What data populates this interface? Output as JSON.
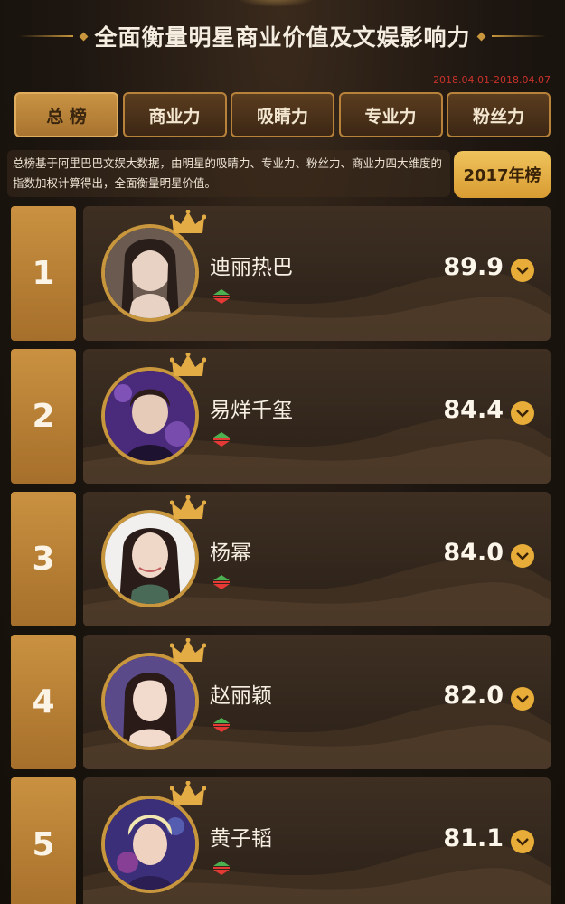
{
  "header": {
    "title": "全面衡量明星商业价值及文娱影响力"
  },
  "date_range": "2018.04.01-2018.04.07",
  "tabs": [
    {
      "label": "总 榜",
      "active": true
    },
    {
      "label": "商业力",
      "active": false
    },
    {
      "label": "吸睛力",
      "active": false
    },
    {
      "label": "专业力",
      "active": false
    },
    {
      "label": "粉丝力",
      "active": false
    }
  ],
  "description": "总榜基于阿里巴巴文娱大数据，由明星的吸睛力、专业力、粉丝力、商业力四大维度的指数加权计算得出，全面衡量明星价值。",
  "year_button": "2017年榜",
  "rankings": [
    {
      "rank": "1",
      "name": "迪丽热巴",
      "score": "89.9"
    },
    {
      "rank": "2",
      "name": "易烊千玺",
      "score": "84.4"
    },
    {
      "rank": "3",
      "name": "杨幂",
      "score": "84.0"
    },
    {
      "rank": "4",
      "name": "赵丽颖",
      "score": "82.0"
    },
    {
      "rank": "5",
      "name": "黄子韬",
      "score": "81.1"
    }
  ],
  "colors": {
    "accent": "#c8963c",
    "active_tab": "#c99344",
    "date_text": "#c8322a",
    "expand_button": "#e7ad38",
    "trend_up": "#4caf50",
    "trend_down": "#e53935"
  }
}
